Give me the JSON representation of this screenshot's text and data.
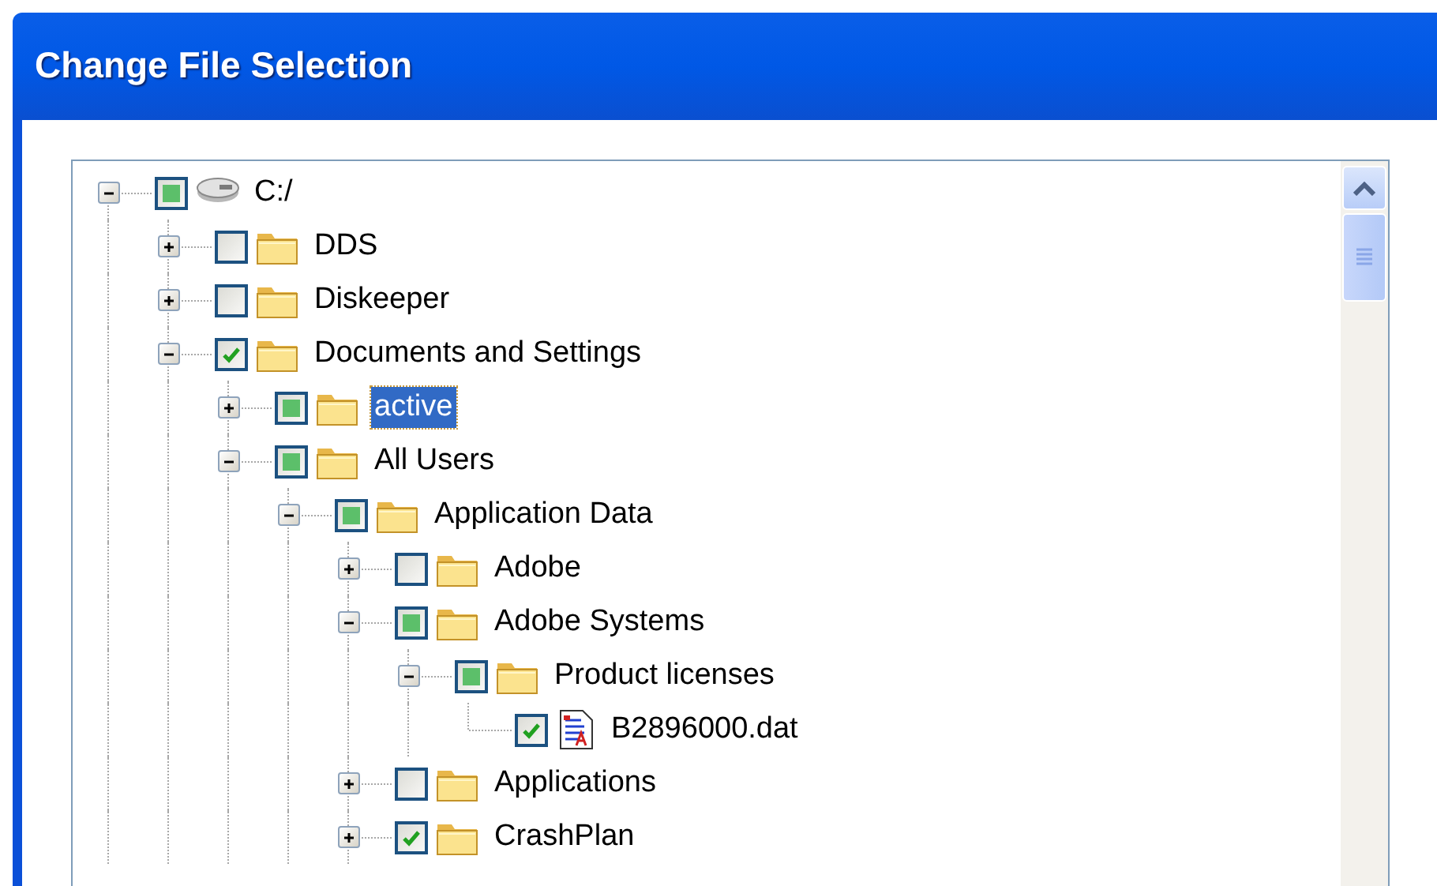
{
  "window": {
    "title": "Change File Selection"
  },
  "tree": [
    {
      "kind": "drive",
      "label": "C:/",
      "checked": false,
      "partial": true,
      "expanded": true,
      "selected": false,
      "children": [
        {
          "kind": "folder",
          "label": "DDS",
          "checked": false,
          "partial": false,
          "expanded": false,
          "selected": false
        },
        {
          "kind": "folder",
          "label": "Diskeeper",
          "checked": false,
          "partial": false,
          "expanded": false,
          "selected": false
        },
        {
          "kind": "folder",
          "label": "Documents and Settings",
          "checked": true,
          "expanded": true,
          "selected": false,
          "children": [
            {
              "kind": "folder",
              "label": "active",
              "checked": false,
              "partial": true,
              "expanded": false,
              "selected": true
            },
            {
              "kind": "folder",
              "label": "All Users",
              "checked": false,
              "partial": true,
              "expanded": true,
              "selected": false,
              "children": [
                {
                  "kind": "folder",
                  "label": "Application Data",
                  "checked": false,
                  "partial": true,
                  "expanded": true,
                  "selected": false,
                  "children": [
                    {
                      "kind": "folder",
                      "label": "Adobe",
                      "checked": false,
                      "partial": false,
                      "expanded": false,
                      "selected": false
                    },
                    {
                      "kind": "folder",
                      "label": "Adobe Systems",
                      "checked": false,
                      "partial": true,
                      "expanded": true,
                      "selected": false,
                      "children": [
                        {
                          "kind": "folder",
                          "label": "Product licenses",
                          "checked": false,
                          "partial": true,
                          "expanded": true,
                          "selected": false,
                          "children": [
                            {
                              "kind": "file",
                              "label": "B2896000.dat",
                              "checked": true,
                              "selected": false
                            }
                          ]
                        }
                      ]
                    },
                    {
                      "kind": "folder",
                      "label": "Applications",
                      "checked": false,
                      "partial": false,
                      "expanded": false,
                      "selected": false
                    },
                    {
                      "kind": "folder",
                      "label": "CrashPlan",
                      "checked": true,
                      "expanded": false,
                      "selected": false
                    }
                  ]
                }
              ]
            }
          ]
        }
      ]
    }
  ]
}
